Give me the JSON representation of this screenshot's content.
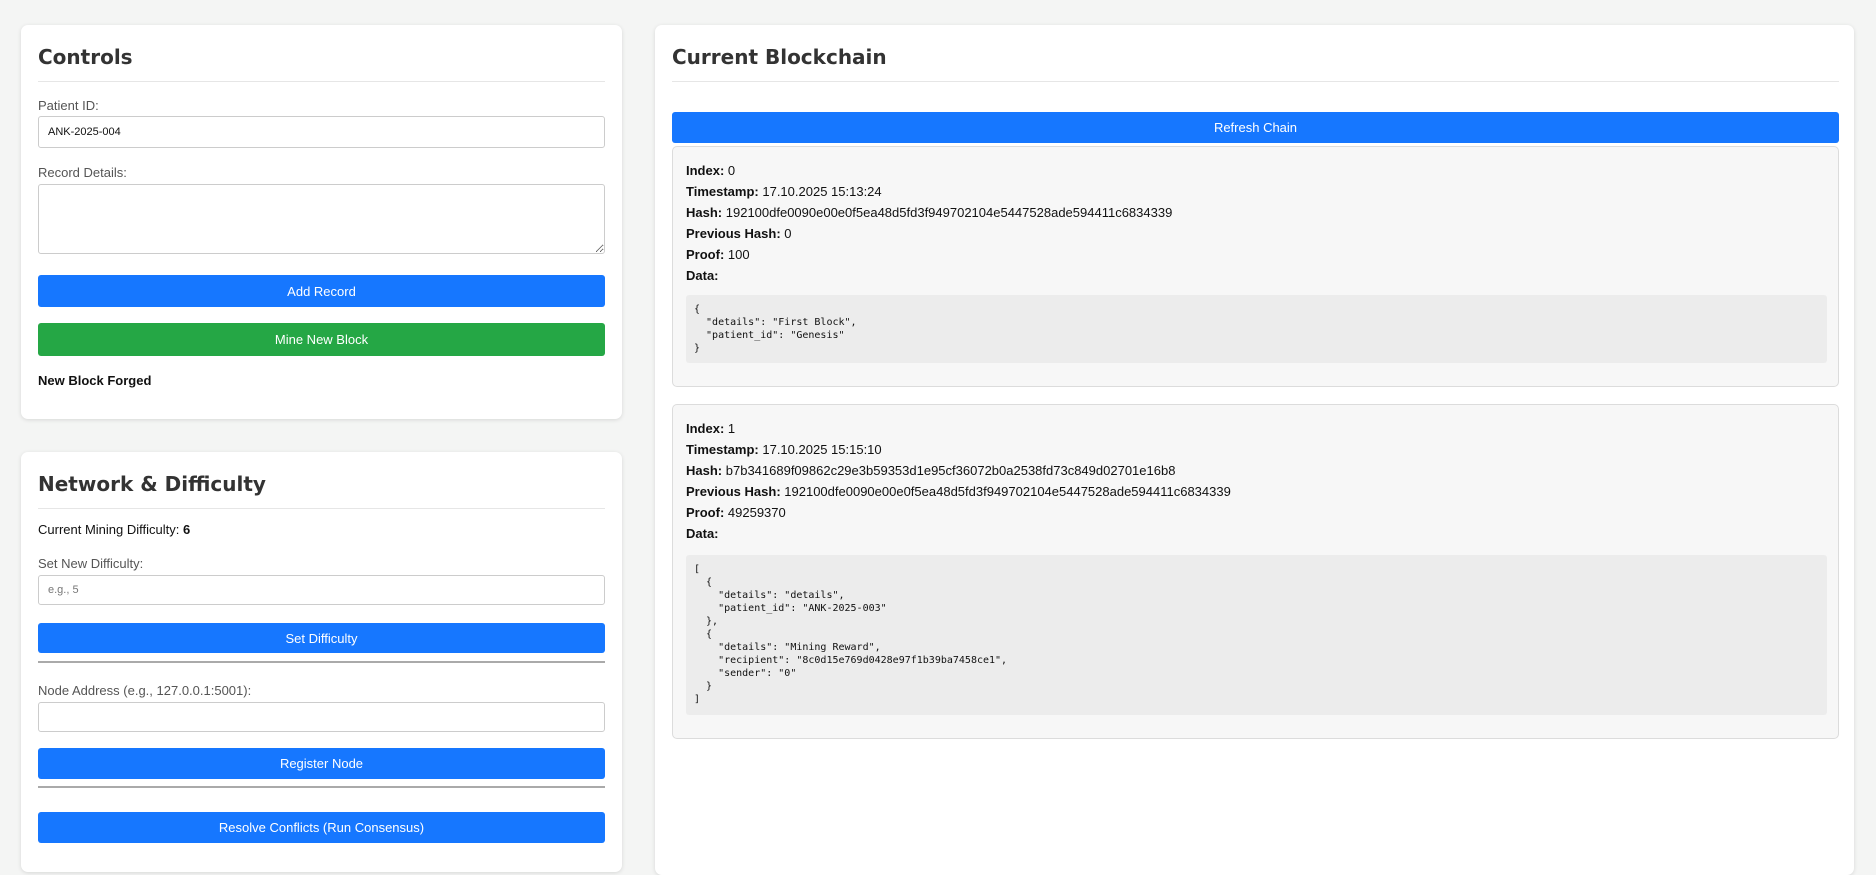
{
  "controls": {
    "title": "Controls",
    "patient_label": "Patient ID:",
    "patient_value": "ANK-2025-004",
    "details_label": "Record Details:",
    "details_value": "",
    "add_button": "Add Record",
    "mine_button": "Mine New Block",
    "status": "New Block Forged"
  },
  "network": {
    "title": "Network & Difficulty",
    "difficulty_label": "Current Mining Difficulty:",
    "difficulty_value": "6",
    "new_difficulty_label": "Set New Difficulty:",
    "new_difficulty_placeholder": "e.g., 5",
    "set_button": "Set Difficulty",
    "node_label": "Node Address (e.g., 127.0.0.1:5001):",
    "node_value": "",
    "register_button": "Register Node",
    "resolve_button": "Resolve Conflicts (Run Consensus)"
  },
  "chain": {
    "title": "Current Blockchain",
    "refresh_button": "Refresh Chain",
    "field_labels": {
      "index": "Index:",
      "timestamp": "Timestamp:",
      "hash": "Hash:",
      "previous_hash": "Previous Hash:",
      "proof": "Proof:",
      "data": "Data:"
    },
    "blocks": [
      {
        "index": "0",
        "timestamp": "17.10.2025 15:13:24",
        "hash": "192100dfe0090e00e0f5ea48d5fd3f949702104e5447528ade594411c6834339",
        "previous_hash": "0",
        "proof": "100",
        "data": "{\n  \"details\": \"First Block\",\n  \"patient_id\": \"Genesis\"\n}"
      },
      {
        "index": "1",
        "timestamp": "17.10.2025 15:15:10",
        "hash": "b7b341689f09862c29e3b59353d1e95cf36072b0a2538fd73c849d02701e16b8",
        "previous_hash": "192100dfe0090e00e0f5ea48d5fd3f949702104e5447528ade594411c6834339",
        "proof": "49259370",
        "data": "[\n  {\n    \"details\": \"details\",\n    \"patient_id\": \"ANK-2025-003\"\n  },\n  {\n    \"details\": \"Mining Reward\",\n    \"recipient\": \"8c0d15e769d0428e97f1b39ba7458ce1\",\n    \"sender\": \"0\"\n  }\n]"
      }
    ]
  }
}
